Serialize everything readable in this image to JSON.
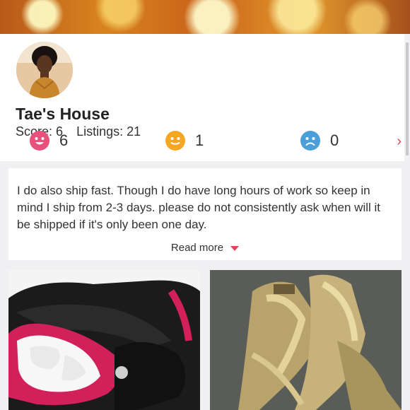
{
  "profile": {
    "name": "Tae's House",
    "score_label": "Score: 6",
    "listings_label": "Listings: 21"
  },
  "ratings": [
    {
      "icon": "happy-face-icon",
      "count": "6",
      "color": "#e9507a"
    },
    {
      "icon": "neutral-face-icon",
      "count": "1",
      "color": "#f5a623"
    },
    {
      "icon": "sad-face-icon",
      "count": "0",
      "color": "#4a9fd8"
    }
  ],
  "about": {
    "text": "I do also ship fast. Though I do have long hours of work so keep in mind I ship from 2-3 days. please do not consistently ask when will it be shipped if it's only been one day.",
    "read_more": "Read more"
  },
  "listings": [
    {
      "icon": "sneaker-photo",
      "alt": "Black and pink sneakers"
    },
    {
      "icon": "heels-photo",
      "alt": "Gold glitter heels"
    }
  ],
  "colors": {
    "accent": "#e2445c"
  }
}
